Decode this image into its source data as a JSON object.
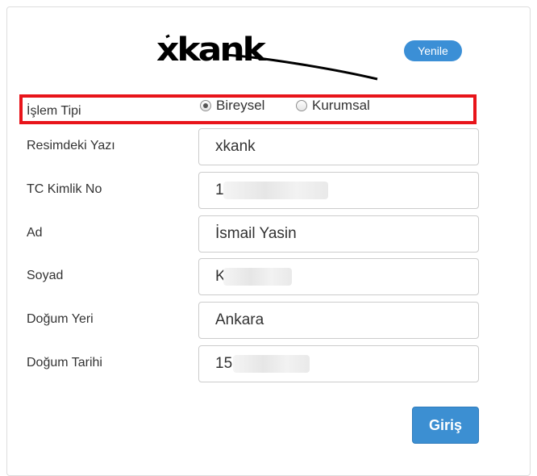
{
  "captcha": {
    "text": "xkank"
  },
  "refresh_label": "Yenile",
  "form": {
    "transaction_type": {
      "label": "İşlem Tipi",
      "options": [
        {
          "label": "Bireysel",
          "checked": true
        },
        {
          "label": "Kurumsal",
          "checked": false
        }
      ]
    },
    "captcha_field": {
      "label": "Resimdeki Yazı",
      "value": "xkank"
    },
    "tc_no": {
      "label": "TC Kimlik No",
      "value": "1"
    },
    "first_name": {
      "label": "Ad",
      "value": "İsmail Yasin"
    },
    "last_name": {
      "label": "Soyad",
      "value": "K"
    },
    "birth_place": {
      "label": "Doğum Yeri",
      "value": "Ankara"
    },
    "birth_date": {
      "label": "Doğum Tarihi",
      "value": "15"
    }
  },
  "submit_label": "Giriş",
  "colors": {
    "accent": "#3c8fd2",
    "highlight": "#e8141a"
  }
}
